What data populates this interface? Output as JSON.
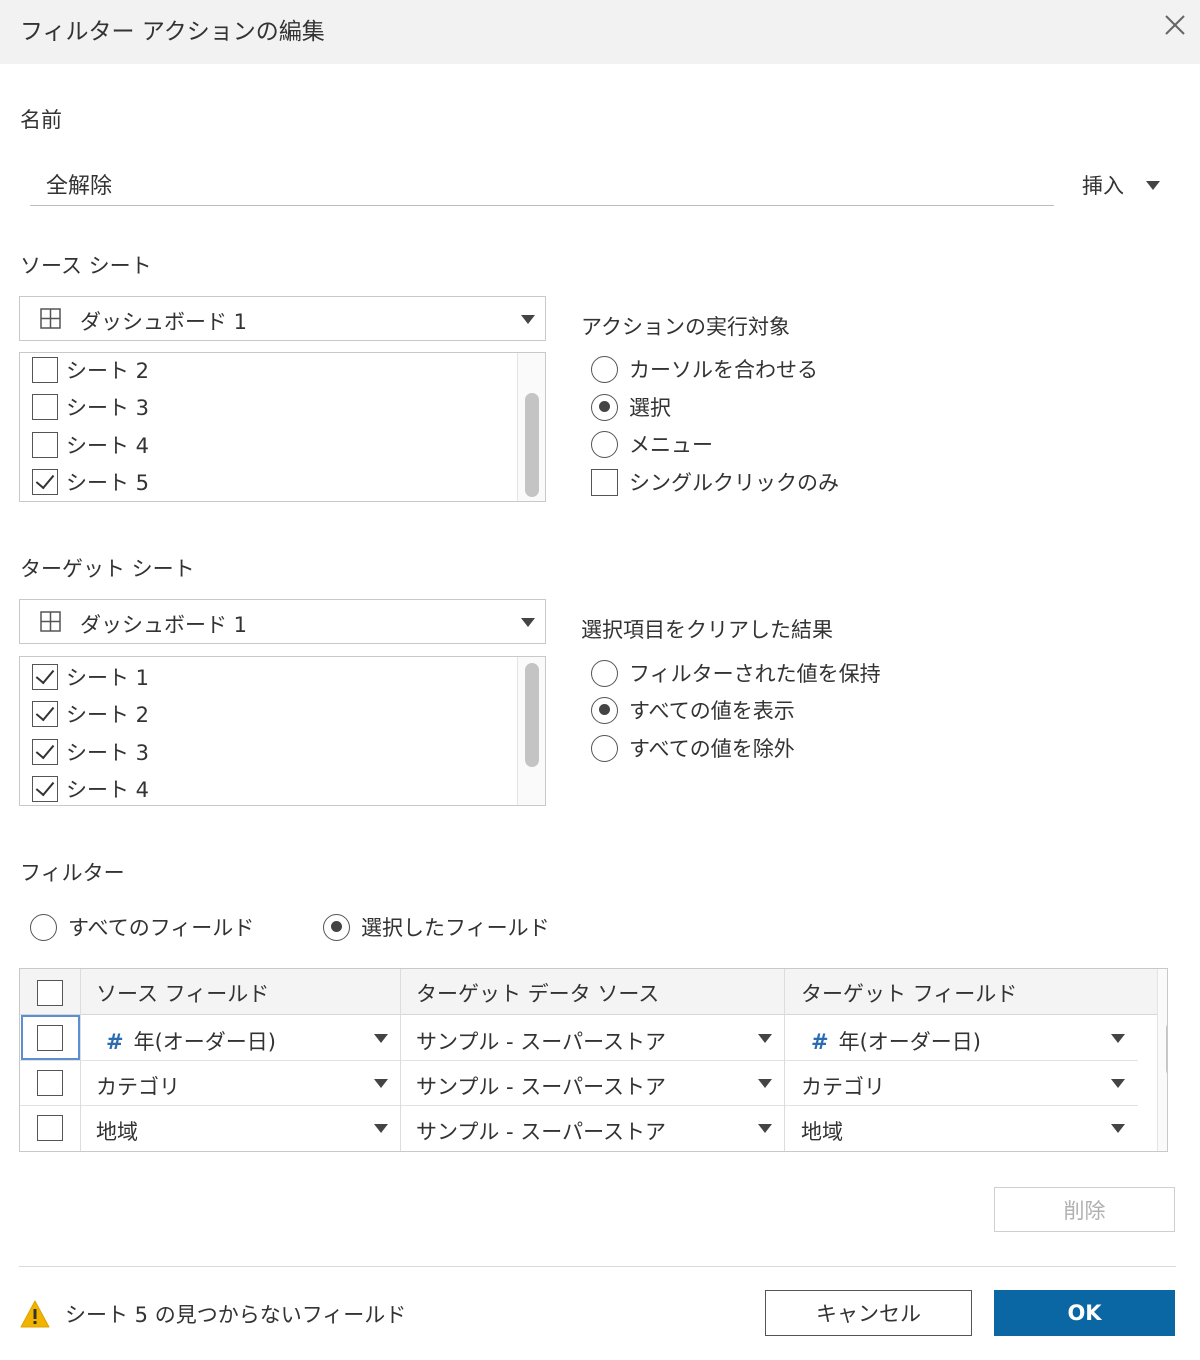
{
  "dialog": {
    "title": "フィルター アクションの編集"
  },
  "name_section": {
    "label": "名前",
    "value": "全解除",
    "insert_label": "挿入"
  },
  "source_sheet": {
    "label": "ソース シート",
    "dropdown_value": "ダッシュボード 1",
    "sheets": [
      {
        "label": "シート 2",
        "checked": false
      },
      {
        "label": "シート 3",
        "checked": false
      },
      {
        "label": "シート 4",
        "checked": false
      },
      {
        "label": "シート 5",
        "checked": true
      }
    ]
  },
  "run_action_on": {
    "label": "アクションの実行対象",
    "options": [
      {
        "label": "カーソルを合わせる",
        "selected": false
      },
      {
        "label": "選択",
        "selected": true
      },
      {
        "label": "メニュー",
        "selected": false
      }
    ],
    "single_click_label": "シングルクリックのみ",
    "single_click_checked": false
  },
  "target_sheet": {
    "label": "ターゲット シート",
    "dropdown_value": "ダッシュボード 1",
    "sheets": [
      {
        "label": "シート 1",
        "checked": true
      },
      {
        "label": "シート 2",
        "checked": true
      },
      {
        "label": "シート 3",
        "checked": true
      },
      {
        "label": "シート 4",
        "checked": true
      }
    ]
  },
  "clearing_selection": {
    "label": "選択項目をクリアした結果",
    "options": [
      {
        "label": "フィルターされた値を保持",
        "selected": false
      },
      {
        "label": "すべての値を表示",
        "selected": true
      },
      {
        "label": "すべての値を除外",
        "selected": false
      }
    ]
  },
  "filters": {
    "label": "フィルター",
    "all_fields_label": "すべてのフィールド",
    "selected_fields_label": "選択したフィールド",
    "mode": "selected",
    "table": {
      "headers": [
        "ソース フィールド",
        "ターゲット データ ソース",
        "ターゲット フィールド"
      ],
      "rows": [
        {
          "source_field": "年(オーダー日)",
          "source_icon": "#",
          "target_data_source": "サンプル - スーパーストア",
          "target_field": "年(オーダー日)",
          "target_icon": "#"
        },
        {
          "source_field": "カテゴリ",
          "source_icon": "",
          "target_data_source": "サンプル - スーパーストア",
          "target_field": "カテゴリ",
          "target_icon": ""
        },
        {
          "source_field": "地域",
          "source_icon": "",
          "target_data_source": "サンプル - スーパーストア",
          "target_field": "地域",
          "target_icon": ""
        }
      ]
    },
    "delete_label": "削除"
  },
  "footer": {
    "warning_text": "シート 5 の見つからないフィールド",
    "cancel_label": "キャンセル",
    "ok_label": "OK"
  },
  "colors": {
    "primary": "#0b67a3",
    "focus": "#5b8fd1",
    "warning": "#f0b400",
    "field_icon": "#2b6cb0"
  }
}
